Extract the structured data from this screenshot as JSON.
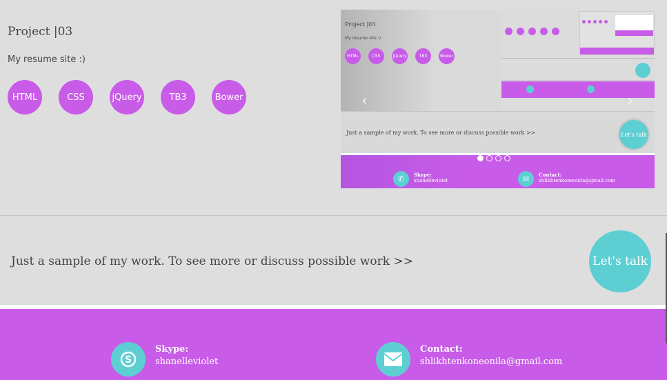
{
  "project": {
    "title": "Project |03",
    "subtitle": "My resume site :)",
    "tags": [
      "HTML",
      "CSS",
      "jQuery",
      "TB3",
      "Bower"
    ]
  },
  "carousel": {
    "prev_icon": "‹",
    "next_icon": "›",
    "slide_count": 4,
    "active_slide": 1,
    "preview": {
      "title": "Project |03",
      "subtitle": "My resume site :)",
      "tags": [
        "HTML",
        "CSS",
        "jQuery",
        "TB3",
        "Bower"
      ],
      "sample_text": "Just a sample of my work. To see more or discuss possible work >>",
      "talk_label": "Let's talk",
      "skype_label": "Skype:",
      "skype_value": "shanelleviolet",
      "contact_label": "Contact:",
      "contact_value": "shlikhtenkoneonila@gmail.com"
    }
  },
  "sample": {
    "text": "Just a sample of my work. To see more or discuss possible work >>",
    "talk_label": "Let's talk"
  },
  "footer": {
    "skype_label": "Skype:",
    "skype_value": "shanelleviolet",
    "contact_label": "Contact:",
    "contact_value": "shlikhtenkoneonila@gmail.com"
  },
  "colors": {
    "accent_purple": "#c85ce8",
    "accent_teal": "#5dcfd3",
    "background": "#dedede"
  },
  "icons": {
    "skype": "skype-icon",
    "mail": "mail-icon"
  }
}
